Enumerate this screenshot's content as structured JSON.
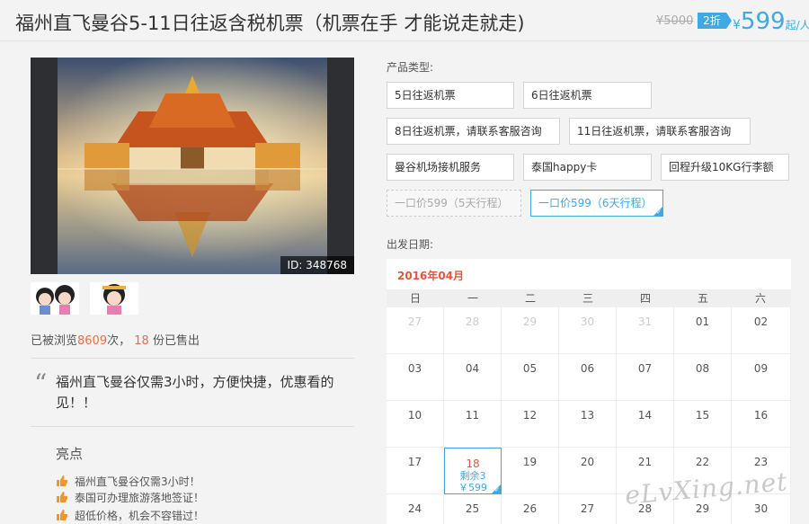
{
  "header": {
    "title": "福州直飞曼谷5-11日往返含税机票（机票在手 才能说走就走)",
    "old_price": "¥5000",
    "discount": "2折",
    "price_currency": "¥",
    "price_value": "599",
    "price_unit": "起/人"
  },
  "gallery": {
    "photo_id": "ID: 348768"
  },
  "stats": {
    "prefix": "已被浏览",
    "views": "8609",
    "mid": "次，",
    "sold": "18",
    "suffix": " 份已售出"
  },
  "quote": {
    "mark": "“",
    "text": "福州直飞曼谷仅需3小时，方便快捷，优惠看的见！！"
  },
  "highlights": {
    "title": "亮点",
    "items": [
      "福州直飞曼谷仅需3小时！",
      "泰国可办理旅游落地签证！",
      "超低价格，机会不容错过！"
    ]
  },
  "product": {
    "label": "产品类型:",
    "options": [
      "5日往返机票",
      "6日往返机票",
      "8日往返机票，请联系客服咨询",
      "11日往返机票，请联系客服咨询",
      "曼谷机场接机服务",
      "泰国happy卡",
      "回程升级10KG行李额",
      "一口价599（5天行程）",
      "一口价599（6天行程）"
    ]
  },
  "departure": {
    "label": "出发日期:"
  },
  "calendar": {
    "month": "2016年04月",
    "weekdays": [
      "日",
      "一",
      "二",
      "三",
      "四",
      "五",
      "六"
    ],
    "rows": [
      [
        "27",
        "28",
        "29",
        "30",
        "31",
        "01",
        "02"
      ],
      [
        "03",
        "04",
        "05",
        "06",
        "07",
        "08",
        "09"
      ],
      [
        "10",
        "11",
        "12",
        "13",
        "14",
        "15",
        "16"
      ],
      [
        "17",
        "18",
        "19",
        "20",
        "21",
        "22",
        "23"
      ],
      [
        "24",
        "25",
        "26",
        "27",
        "28",
        "29",
        "30"
      ]
    ],
    "selected_remaining": "剩余3",
    "selected_price": "￥599"
  },
  "watermark": "eLvXing.net",
  "colors": {
    "accent": "#3fa9e6",
    "highlight": "#ef6c48",
    "month": "#e5553e"
  }
}
